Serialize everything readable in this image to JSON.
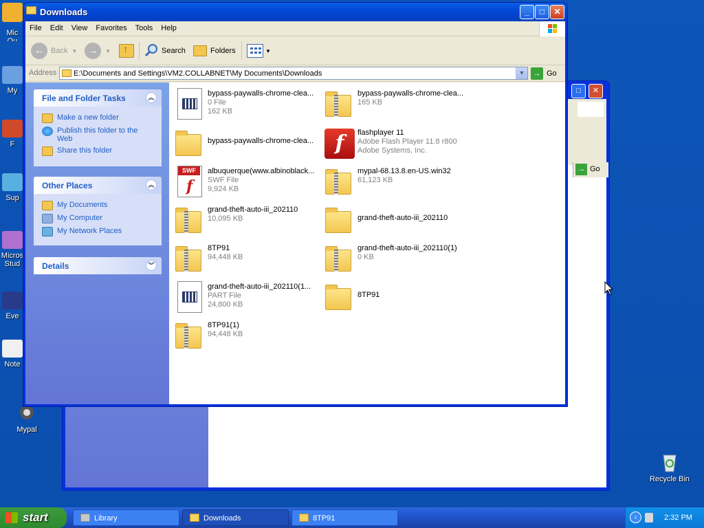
{
  "desktop": {
    "icons": [
      {
        "label": "Mypal"
      },
      {
        "label": "Recycle Bin"
      }
    ],
    "cut_labels": [
      "Mic\nOu",
      "My",
      "F",
      "Sup",
      "Micros\nStud",
      "Eve",
      "Note"
    ]
  },
  "window": {
    "title": "Downloads",
    "controls": {
      "minimize": "_",
      "maximize": "□",
      "close": "✕"
    },
    "menu": [
      "File",
      "Edit",
      "View",
      "Favorites",
      "Tools",
      "Help"
    ],
    "toolbar": {
      "back": "Back",
      "search": "Search",
      "folders": "Folders"
    },
    "address": {
      "label": "Address",
      "value": "E:\\Documents and Settings\\VM2.COLLABNET\\My Documents\\Downloads",
      "go": "Go"
    }
  },
  "back_window": {
    "go": "Go"
  },
  "sidebar": {
    "file_tasks": {
      "title": "File and Folder Tasks",
      "items": [
        "Make a new folder",
        "Publish this folder to the Web",
        "Share this folder"
      ]
    },
    "other_places": {
      "title": "Other Places",
      "items": [
        "My Documents",
        "My Computer",
        "My Network Places"
      ]
    },
    "details": {
      "title": "Details"
    }
  },
  "files": [
    {
      "name": "bypass-paywalls-chrome-clea...",
      "type": "0 File",
      "size": "162 KB",
      "icon": "document-icon"
    },
    {
      "name": "bypass-paywalls-chrome-clea...",
      "type": "165 KB",
      "size": "",
      "icon": "zip-folder-icon"
    },
    {
      "name": "bypass-paywalls-chrome-clea...",
      "type": "",
      "size": "",
      "icon": "folder-icon"
    },
    {
      "name": "flashplayer 11",
      "type": "Adobe Flash Player 11.8 r800",
      "size": "Adobe Systems, Inc.",
      "icon": "flash-player-icon"
    },
    {
      "name": "albuquerque(www.albinoblack...",
      "type": "SWF File",
      "size": "9,924 KB",
      "icon": "swf-file-icon"
    },
    {
      "name": "mypal-68.13.8.en-US.win32",
      "type": "61,123 KB",
      "size": "",
      "icon": "zip-folder-icon"
    },
    {
      "name": "grand-theft-auto-iii_202110",
      "type": "10,095 KB",
      "size": "",
      "icon": "zip-folder-icon"
    },
    {
      "name": "grand-theft-auto-iii_202110",
      "type": "",
      "size": "",
      "icon": "folder-icon"
    },
    {
      "name": "8TP91",
      "type": "94,448 KB",
      "size": "",
      "icon": "zip-folder-icon"
    },
    {
      "name": "grand-theft-auto-iii_202110(1)",
      "type": "0 KB",
      "size": "",
      "icon": "zip-folder-icon"
    },
    {
      "name": "grand-theft-auto-iii_202110(1...",
      "type": "PART File",
      "size": "24,800 KB",
      "icon": "document-icon"
    },
    {
      "name": "8TP91",
      "type": "",
      "size": "",
      "icon": "folder-icon"
    },
    {
      "name": "8TP91(1)",
      "type": "94,448 KB",
      "size": "",
      "icon": "zip-folder-icon"
    }
  ],
  "taskbar": {
    "start": "start",
    "tasks": [
      {
        "label": "Library",
        "active": false
      },
      {
        "label": "Downloads",
        "active": true
      },
      {
        "label": "8TP91",
        "active": false
      }
    ],
    "clock": "2:32 PM"
  }
}
